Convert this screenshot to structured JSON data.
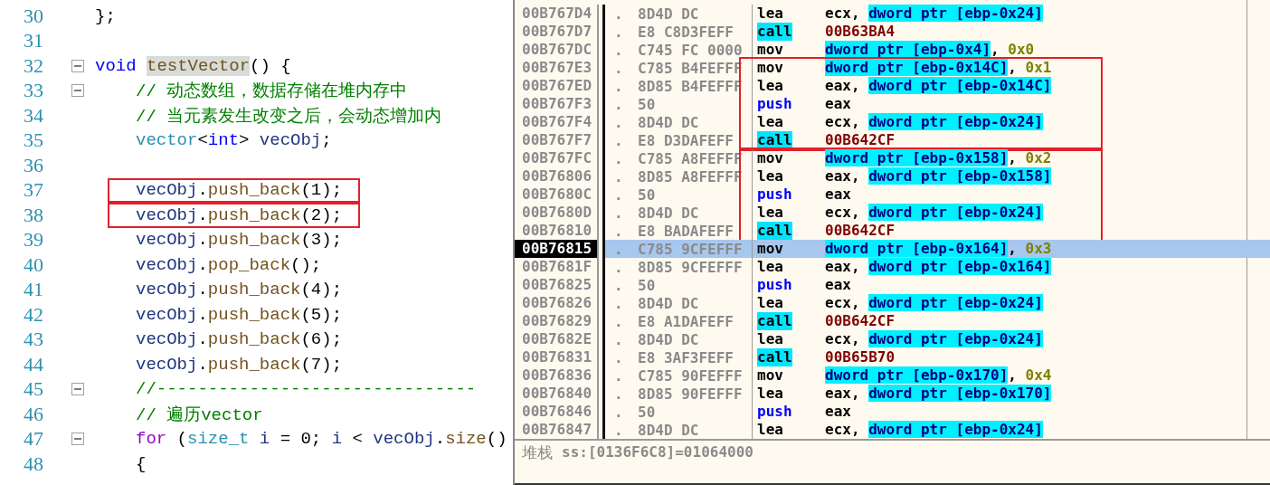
{
  "editor": {
    "lines": [
      {
        "number": "30",
        "fold_marker": false,
        "framed": false,
        "tokens": [
          {
            "kind": "pun",
            "text": "};"
          }
        ]
      },
      {
        "number": "31",
        "fold_marker": false,
        "framed": false
      },
      {
        "number": "32",
        "fold_marker": true,
        "framed": false,
        "tokens": [
          {
            "kind": "kw",
            "text": "void "
          },
          {
            "kind": "fnhl",
            "text": "testVector"
          },
          {
            "kind": "pun",
            "text": "() {"
          }
        ],
        "children": [
          {
            "number": "33",
            "fold_marker": true,
            "framed": false,
            "tokens": [
              {
                "kind": "com",
                "text": "// 动态数组，数据存储在堆内存中"
              }
            ]
          },
          {
            "number": "34",
            "fold_marker": false,
            "framed": false,
            "tokens": [
              {
                "kind": "com",
                "text": "// 当元素发生改变之后，会动态增加内"
              }
            ]
          },
          {
            "number": "35",
            "fold_marker": false,
            "framed": false,
            "tokens": [
              {
                "kind": "type",
                "text": "vector"
              },
              {
                "kind": "pun",
                "text": "<"
              },
              {
                "kind": "kw",
                "text": "int"
              },
              {
                "kind": "pun",
                "text": "> "
              },
              {
                "kind": "var",
                "text": "vecObj"
              },
              {
                "kind": "pun",
                "text": ";"
              }
            ]
          },
          {
            "number": "36",
            "fold_marker": false,
            "framed": false
          },
          {
            "number": "37",
            "fold_marker": false,
            "framed": true,
            "tokens": [
              {
                "kind": "var",
                "text": "vecObj"
              },
              {
                "kind": "pun",
                "text": "."
              },
              {
                "kind": "fn",
                "text": "push_back"
              },
              {
                "kind": "pun",
                "text": "(1);"
              }
            ]
          },
          {
            "number": "38",
            "fold_marker": false,
            "framed": true,
            "tokens": [
              {
                "kind": "var",
                "text": "vecObj"
              },
              {
                "kind": "pun",
                "text": "."
              },
              {
                "kind": "fn",
                "text": "push_back"
              },
              {
                "kind": "pun",
                "text": "(2);"
              }
            ]
          },
          {
            "number": "39",
            "fold_marker": false,
            "framed": false,
            "tokens": [
              {
                "kind": "var",
                "text": "vecObj"
              },
              {
                "kind": "pun",
                "text": "."
              },
              {
                "kind": "fn",
                "text": "push_back"
              },
              {
                "kind": "pun",
                "text": "(3);"
              }
            ]
          },
          {
            "number": "40",
            "fold_marker": false,
            "framed": false,
            "tokens": [
              {
                "kind": "var",
                "text": "vecObj"
              },
              {
                "kind": "pun",
                "text": "."
              },
              {
                "kind": "fn",
                "text": "pop_back"
              },
              {
                "kind": "pun",
                "text": "();"
              }
            ]
          },
          {
            "number": "41",
            "fold_marker": false,
            "framed": false,
            "tokens": [
              {
                "kind": "var",
                "text": "vecObj"
              },
              {
                "kind": "pun",
                "text": "."
              },
              {
                "kind": "fn",
                "text": "push_back"
              },
              {
                "kind": "pun",
                "text": "(4);"
              }
            ]
          },
          {
            "number": "42",
            "fold_marker": false,
            "framed": false,
            "tokens": [
              {
                "kind": "var",
                "text": "vecObj"
              },
              {
                "kind": "pun",
                "text": "."
              },
              {
                "kind": "fn",
                "text": "push_back"
              },
              {
                "kind": "pun",
                "text": "(5);"
              }
            ]
          },
          {
            "number": "43",
            "fold_marker": false,
            "framed": false,
            "tokens": [
              {
                "kind": "var",
                "text": "vecObj"
              },
              {
                "kind": "pun",
                "text": "."
              },
              {
                "kind": "fn",
                "text": "push_back"
              },
              {
                "kind": "pun",
                "text": "(6);"
              }
            ]
          },
          {
            "number": "44",
            "fold_marker": false,
            "framed": false,
            "tokens": [
              {
                "kind": "var",
                "text": "vecObj"
              },
              {
                "kind": "pun",
                "text": "."
              },
              {
                "kind": "fn",
                "text": "push_back"
              },
              {
                "kind": "pun",
                "text": "(7);"
              }
            ]
          },
          {
            "number": "45",
            "fold_marker": true,
            "framed": false,
            "tokens": [
              {
                "kind": "com",
                "text": "//-------------------------------"
              }
            ]
          },
          {
            "number": "46",
            "fold_marker": false,
            "framed": false,
            "tokens": [
              {
                "kind": "com",
                "text": "// 遍历vector"
              }
            ]
          },
          {
            "number": "47",
            "fold_marker": true,
            "framed": false,
            "tokens": [
              {
                "kind": "ctl",
                "text": "for"
              },
              {
                "kind": "pun",
                "text": " ("
              },
              {
                "kind": "type",
                "text": "size_t "
              },
              {
                "kind": "var",
                "text": "i"
              },
              {
                "kind": "pun",
                "text": " = 0; "
              },
              {
                "kind": "var",
                "text": "i"
              },
              {
                "kind": "pun",
                "text": " < "
              },
              {
                "kind": "var",
                "text": "vecObj"
              },
              {
                "kind": "pun",
                "text": "."
              },
              {
                "kind": "fn",
                "text": "size"
              },
              {
                "kind": "pun",
                "text": "()"
              }
            ]
          },
          {
            "number": "48",
            "fold_marker": false,
            "framed": false,
            "tokens": [
              {
                "kind": "pun",
                "text": "{"
              }
            ]
          }
        ]
      }
    ]
  },
  "debugger": {
    "blocks": [
      {
        "framed": false,
        "rows": [
          {
            "address": "00B767D4",
            "dot": ".",
            "hex": "8D4D DC",
            "mnemonic": "lea",
            "kind": "plain",
            "selected": false,
            "operand": [
              {
                "kind": "reg",
                "text": "ecx, "
              },
              {
                "kind": "mem",
                "text": "dword ptr [ebp-0x24]"
              }
            ]
          },
          {
            "address": "00B767D7",
            "dot": ".",
            "hex": "E8 C8D3FEFF",
            "mnemonic": "call",
            "kind": "call",
            "selected": false,
            "operand": [
              {
                "kind": "addr",
                "text": "00B63BA4"
              }
            ]
          },
          {
            "address": "00B767DC",
            "dot": ".",
            "hex": "C745 FC 0000",
            "mnemonic": "mov",
            "kind": "plain",
            "selected": false,
            "operand": [
              {
                "kind": "mem",
                "text": "dword ptr [ebp-0x4]"
              },
              {
                "kind": "reg",
                "text": ", "
              },
              {
                "kind": "imm",
                "text": "0x0"
              }
            ]
          }
        ]
      },
      {
        "framed": true,
        "rows": [
          {
            "address": "00B767E3",
            "dot": ".",
            "hex": "C785 B4FEFFF",
            "mnemonic": "mov",
            "kind": "plain",
            "selected": false,
            "operand": [
              {
                "kind": "mem",
                "text": "dword ptr [ebp-0x14C]"
              },
              {
                "kind": "reg",
                "text": ", "
              },
              {
                "kind": "imm",
                "text": "0x1"
              }
            ]
          },
          {
            "address": "00B767ED",
            "dot": ".",
            "hex": "8D85 B4FEFFF",
            "mnemonic": "lea",
            "kind": "plain",
            "selected": false,
            "operand": [
              {
                "kind": "reg",
                "text": "eax, "
              },
              {
                "kind": "mem",
                "text": "dword ptr [ebp-0x14C]"
              }
            ]
          },
          {
            "address": "00B767F3",
            "dot": ".",
            "hex": "50",
            "mnemonic": "push",
            "kind": "push",
            "selected": false,
            "operand": [
              {
                "kind": "reg",
                "text": "eax"
              }
            ]
          },
          {
            "address": "00B767F4",
            "dot": ".",
            "hex": "8D4D DC",
            "mnemonic": "lea",
            "kind": "plain",
            "selected": false,
            "operand": [
              {
                "kind": "reg",
                "text": "ecx, "
              },
              {
                "kind": "mem",
                "text": "dword ptr [ebp-0x24]"
              }
            ]
          },
          {
            "address": "00B767F7",
            "dot": ".",
            "hex": "E8 D3DAFEFF",
            "mnemonic": "call",
            "kind": "call",
            "selected": false,
            "operand": [
              {
                "kind": "addr",
                "text": "00B642CF"
              }
            ]
          }
        ]
      },
      {
        "framed": true,
        "rows": [
          {
            "address": "00B767FC",
            "dot": ".",
            "hex": "C785 A8FEFFF",
            "mnemonic": "mov",
            "kind": "plain",
            "selected": false,
            "operand": [
              {
                "kind": "mem",
                "text": "dword ptr [ebp-0x158]"
              },
              {
                "kind": "reg",
                "text": ", "
              },
              {
                "kind": "imm",
                "text": "0x2"
              }
            ]
          },
          {
            "address": "00B76806",
            "dot": ".",
            "hex": "8D85 A8FEFFF",
            "mnemonic": "lea",
            "kind": "plain",
            "selected": false,
            "operand": [
              {
                "kind": "reg",
                "text": "eax, "
              },
              {
                "kind": "mem",
                "text": "dword ptr [ebp-0x158]"
              }
            ]
          },
          {
            "address": "00B7680C",
            "dot": ".",
            "hex": "50",
            "mnemonic": "push",
            "kind": "push",
            "selected": false,
            "operand": [
              {
                "kind": "reg",
                "text": "eax"
              }
            ]
          },
          {
            "address": "00B7680D",
            "dot": ".",
            "hex": "8D4D DC",
            "mnemonic": "lea",
            "kind": "plain",
            "selected": false,
            "operand": [
              {
                "kind": "reg",
                "text": "ecx, "
              },
              {
                "kind": "mem",
                "text": "dword ptr [ebp-0x24]"
              }
            ]
          },
          {
            "address": "00B76810",
            "dot": ".",
            "hex": "E8 BADAFEFF",
            "mnemonic": "call",
            "kind": "call",
            "selected": false,
            "operand": [
              {
                "kind": "addr",
                "text": "00B642CF"
              }
            ]
          }
        ]
      },
      {
        "framed": false,
        "rows": [
          {
            "address": "00B76815",
            "dot": ".",
            "hex": "C785 9CFEFFF",
            "mnemonic": "mov",
            "kind": "plain",
            "selected": true,
            "operand": [
              {
                "kind": "mem",
                "text": "dword ptr [ebp-0x164]"
              },
              {
                "kind": "reg",
                "text": ", "
              },
              {
                "kind": "imm",
                "text": "0x3"
              }
            ]
          },
          {
            "address": "00B7681F",
            "dot": ".",
            "hex": "8D85 9CFEFFF",
            "mnemonic": "lea",
            "kind": "plain",
            "selected": false,
            "operand": [
              {
                "kind": "reg",
                "text": "eax, "
              },
              {
                "kind": "mem",
                "text": "dword ptr [ebp-0x164]"
              }
            ]
          },
          {
            "address": "00B76825",
            "dot": ".",
            "hex": "50",
            "mnemonic": "push",
            "kind": "push",
            "selected": false,
            "operand": [
              {
                "kind": "reg",
                "text": "eax"
              }
            ]
          },
          {
            "address": "00B76826",
            "dot": ".",
            "hex": "8D4D DC",
            "mnemonic": "lea",
            "kind": "plain",
            "selected": false,
            "operand": [
              {
                "kind": "reg",
                "text": "ecx, "
              },
              {
                "kind": "mem",
                "text": "dword ptr [ebp-0x24]"
              }
            ]
          },
          {
            "address": "00B76829",
            "dot": ".",
            "hex": "E8 A1DAFEFF",
            "mnemonic": "call",
            "kind": "call",
            "selected": false,
            "operand": [
              {
                "kind": "addr",
                "text": "00B642CF"
              }
            ]
          },
          {
            "address": "00B7682E",
            "dot": ".",
            "hex": "8D4D DC",
            "mnemonic": "lea",
            "kind": "plain",
            "selected": false,
            "operand": [
              {
                "kind": "reg",
                "text": "ecx, "
              },
              {
                "kind": "mem",
                "text": "dword ptr [ebp-0x24]"
              }
            ]
          },
          {
            "address": "00B76831",
            "dot": ".",
            "hex": "E8 3AF3FEFF",
            "mnemonic": "call",
            "kind": "call",
            "selected": false,
            "operand": [
              {
                "kind": "addr",
                "text": "00B65B70"
              }
            ]
          },
          {
            "address": "00B76836",
            "dot": ".",
            "hex": "C785 90FEFFF",
            "mnemonic": "mov",
            "kind": "plain",
            "selected": false,
            "operand": [
              {
                "kind": "mem",
                "text": "dword ptr [ebp-0x170]"
              },
              {
                "kind": "reg",
                "text": ", "
              },
              {
                "kind": "imm",
                "text": "0x4"
              }
            ]
          },
          {
            "address": "00B76840",
            "dot": ".",
            "hex": "8D85 90FEFFF",
            "mnemonic": "lea",
            "kind": "plain",
            "selected": false,
            "operand": [
              {
                "kind": "reg",
                "text": "eax, "
              },
              {
                "kind": "mem",
                "text": "dword ptr [ebp-0x170]"
              }
            ]
          },
          {
            "address": "00B76846",
            "dot": ".",
            "hex": "50",
            "mnemonic": "push",
            "kind": "push",
            "selected": false,
            "operand": [
              {
                "kind": "reg",
                "text": "eax"
              }
            ]
          },
          {
            "address": "00B76847",
            "dot": ".",
            "hex": "8D4D DC",
            "mnemonic": "lea",
            "kind": "plain",
            "selected": false,
            "operand": [
              {
                "kind": "reg",
                "text": "ecx, "
              },
              {
                "kind": "mem",
                "text": "dword ptr [ebp-0x24]"
              }
            ]
          }
        ]
      }
    ],
    "info": {
      "label": "堆栈",
      "value": "ss:[0136F6C8]=01064000"
    }
  }
}
